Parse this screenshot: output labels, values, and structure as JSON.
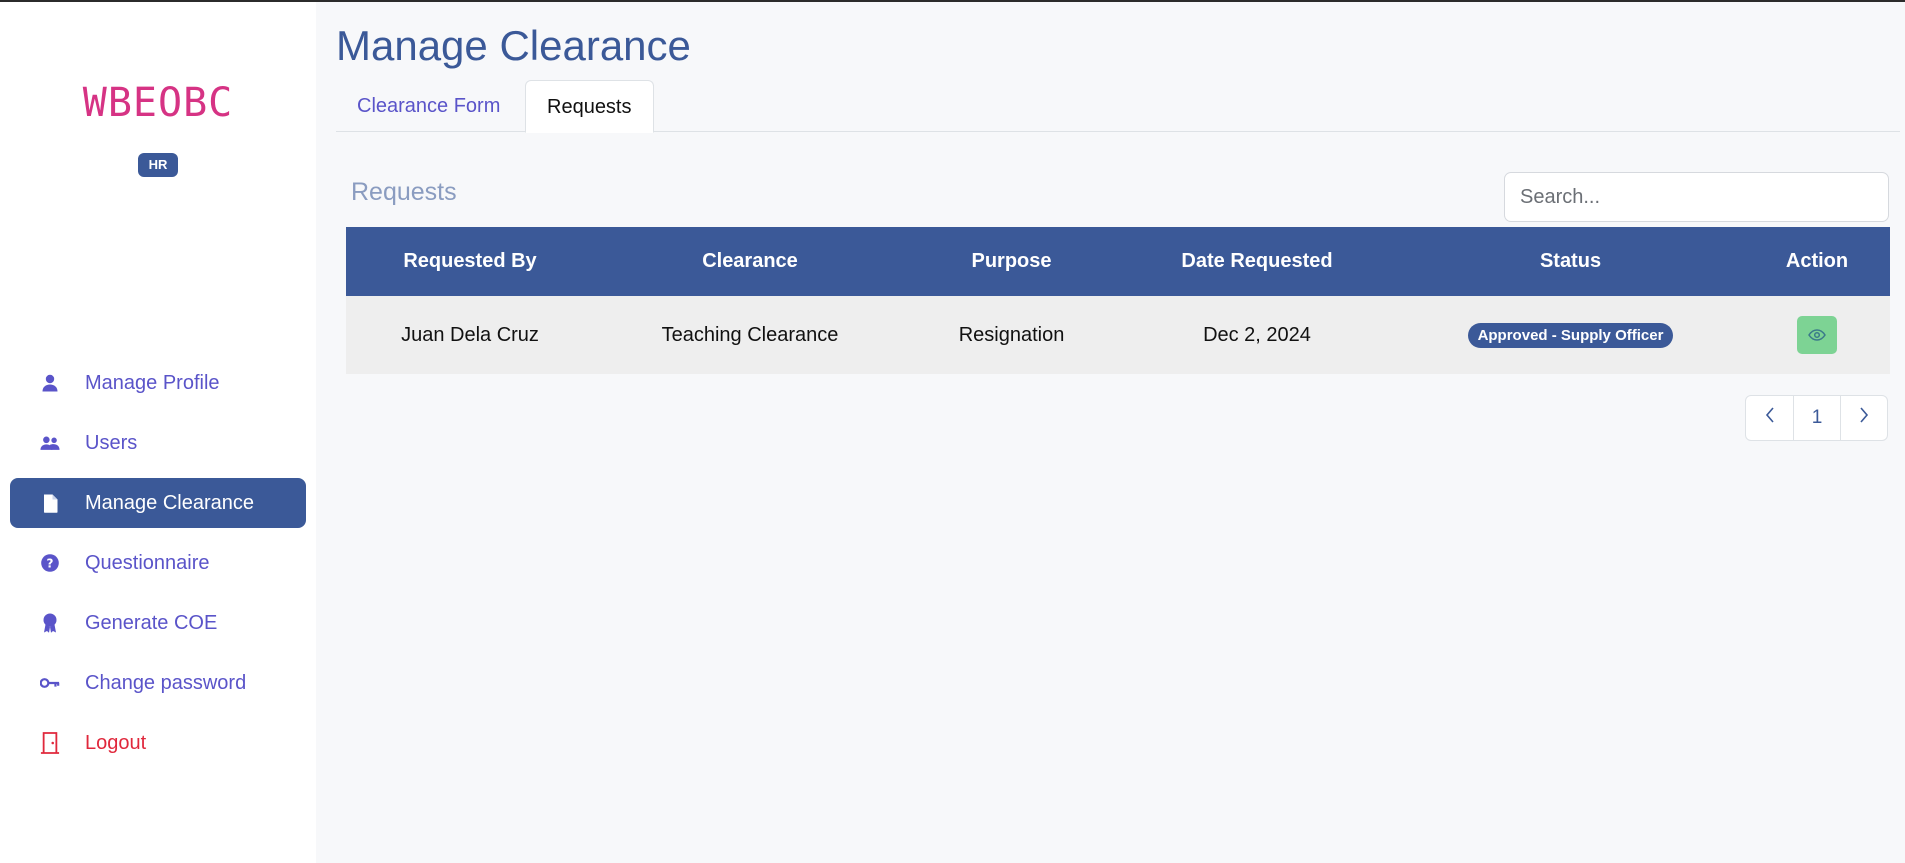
{
  "app": {
    "brand": "WBEOBC",
    "role_badge": "HR"
  },
  "sidebar": {
    "items": [
      {
        "label": "Manage Profile",
        "icon": "user-icon",
        "active": false
      },
      {
        "label": "Users",
        "icon": "users-icon",
        "active": false
      },
      {
        "label": "Manage Clearance",
        "icon": "file-icon",
        "active": true
      },
      {
        "label": "Questionnaire",
        "icon": "question-circle-icon",
        "active": false
      },
      {
        "label": "Generate COE",
        "icon": "award-icon",
        "active": false
      },
      {
        "label": "Change password",
        "icon": "key-icon",
        "active": false
      }
    ],
    "logout": {
      "label": "Logout",
      "icon": "door-exit-icon"
    }
  },
  "main": {
    "title": "Manage Clearance",
    "tabs": [
      {
        "label": "Clearance Form",
        "active": false
      },
      {
        "label": "Requests",
        "active": true
      }
    ],
    "section_title": "Requests",
    "search": {
      "placeholder": "Search...",
      "value": ""
    },
    "table": {
      "headers": [
        "Requested By",
        "Clearance",
        "Purpose",
        "Date Requested",
        "Status",
        "Action"
      ],
      "rows": [
        {
          "requested_by": "Juan Dela Cruz",
          "clearance": "Teaching Clearance",
          "purpose": "Resignation",
          "date_requested": "Dec 2, 2024",
          "status": "Approved - Supply Officer",
          "action_icon": "eye-icon"
        }
      ]
    },
    "pagination": {
      "current_page": "1",
      "prev_icon": "chevron-left-icon",
      "next_icon": "chevron-right-icon"
    }
  },
  "colors": {
    "primary": "#3b5998",
    "brand": "#d63384",
    "nav_text": "#5a54c9",
    "logout": "#e0283c",
    "view_button": "#7dd394",
    "section_title": "#8a9cc0"
  }
}
